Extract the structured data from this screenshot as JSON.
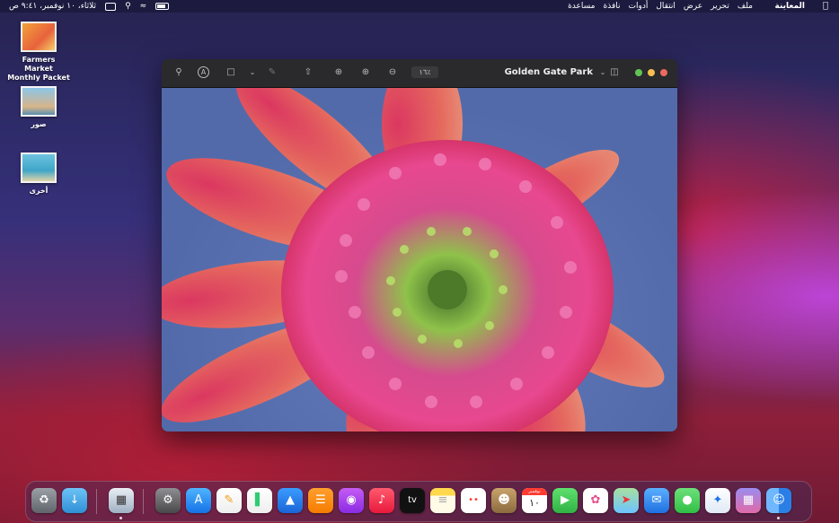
{
  "menubar": {
    "app_name": "المعاينة",
    "menus": [
      "ملف",
      "تحرير",
      "عرض",
      "انتقال",
      "أدوات",
      "نافذة",
      "مساعدة"
    ],
    "clock": "ثلاثاء، ١٠ نوفمبر، ٩:٤١ ص"
  },
  "desktop": {
    "items": [
      {
        "label": "Farmers Market Monthly Packet"
      },
      {
        "label": "صور"
      },
      {
        "label": "أخرى"
      }
    ]
  },
  "window": {
    "title": "Golden Gate Park",
    "zoom": "١٦٪"
  },
  "dock": {
    "calendar_month": "نوفمبر",
    "calendar_day": "١٠",
    "apps": [
      "trash",
      "downloads",
      "preview",
      "system-preferences",
      "app-store",
      "pages",
      "numbers",
      "keynote",
      "books",
      "podcasts",
      "music",
      "tv",
      "notes",
      "reminders",
      "contacts",
      "calendar",
      "facetime",
      "photos",
      "maps",
      "mail",
      "messages",
      "safari",
      "launchpad",
      "finder"
    ]
  },
  "colors": {
    "close": "#ed6a5e",
    "minimize": "#f5bf4f",
    "zoom": "#61c554"
  }
}
